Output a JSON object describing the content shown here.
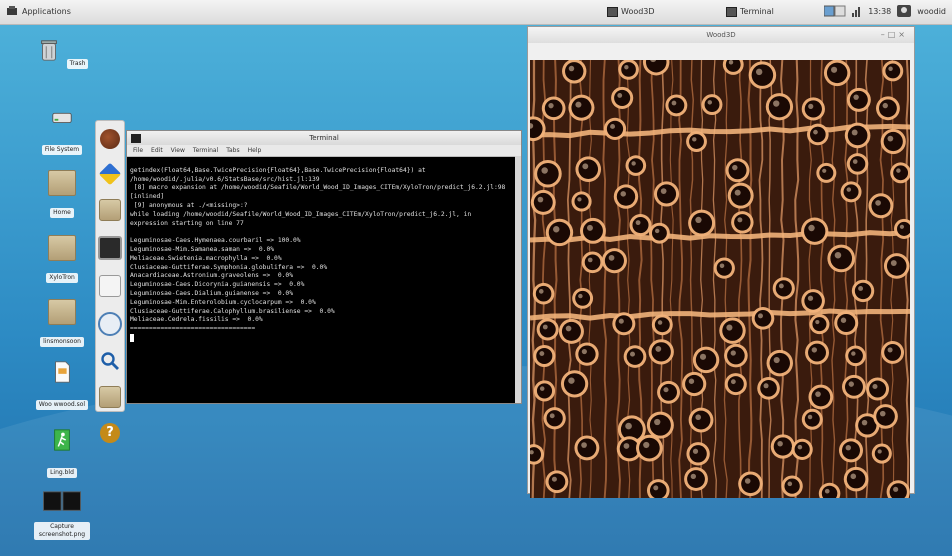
{
  "top_panel": {
    "apps_label": "Applications",
    "tasks": [
      "Wood3D",
      "Terminal"
    ],
    "clock": "13:38",
    "user": "woodid"
  },
  "desktop_icons": [
    {
      "label": "Trash",
      "icon": "trash-icon"
    },
    {
      "label": "File System",
      "icon": "drive-icon"
    },
    {
      "label": "Home",
      "icon": "folder-icon"
    },
    {
      "label": "XyloTron",
      "icon": "folder-icon"
    },
    {
      "label": "linsmonsoon",
      "icon": "folder-icon"
    },
    {
      "label": "Woo wwood.sol",
      "icon": "document-icon"
    },
    {
      "label": "Ling.bld",
      "icon": "runner-icon"
    },
    {
      "label": "Capture screenshot.png",
      "icon": "image-icon"
    }
  ],
  "dock_icons": [
    "ball-icon",
    "browser-icon",
    "folder-icon",
    "monitor-icon",
    "notes-icon",
    "clock-icon",
    "magnifier-icon",
    "files-icon",
    "help-icon"
  ],
  "terminal": {
    "title": "Terminal",
    "menu": [
      "File",
      "Edit",
      "View",
      "Terminal",
      "Tabs",
      "Help"
    ],
    "lines": [
      "getindex(Float64,Base.TwicePrecision{Float64},Base.TwicePrecision{Float64}) at /home/woodid/.julia/v0.6/StatsBase/src/hist.jl:139",
      " [8] macro expansion at /home/woodid/Seafile/World_Wood_ID_Images_CITEm/XyloTron/predict_j6.2.jl:98 [inlined]",
      " [9] anonymous at ./<missing>:?",
      "while loading /home/woodid/Seafile/World_Wood_ID_Images_CITEm/XyloTron/predict_j6.2.jl, in expression starting on line 77",
      "",
      "Leguminosae-Caes.Hymenaea.courbaril => 100.0%",
      "Leguminosae-Mim.Samanea.saman =>  0.0%",
      "Meliaceae.Swietenia.macrophylla =>  0.0%",
      "Clusiaceae-Guttiferae.Symphonia.globulifera =>  0.0%",
      "Anacardiaceae.Astronium.graveolens =>  0.0%",
      "Leguminosae-Caes.Dicorynia.guianensis =>  0.0%",
      "Leguminosae-Caes.Dialium.guianense =>  0.0%",
      "Leguminosae-Mim.Enterolobium.cyclocarpum =>  0.0%",
      "Clusiaceae-Guttiferae.Calophyllum.brasiliense =>  0.0%",
      "Meliaceae.Cedrela.fissilis =>  0.0%",
      "================================="
    ]
  },
  "viewer": {
    "title": "Wood3D",
    "image": "wood-cross-section-micrograph"
  },
  "colors": {
    "desktop_top": "#4fb3db",
    "desktop_bottom": "#1f6fab",
    "wood_dark": "#3a1b0d",
    "wood_light": "#f1b27a"
  }
}
